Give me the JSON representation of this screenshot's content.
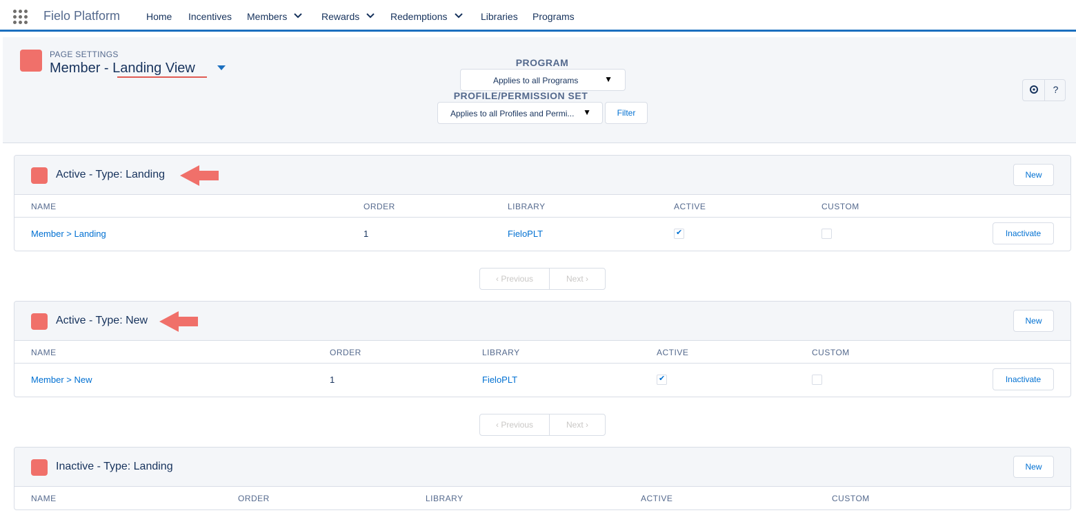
{
  "topnav": {
    "app_name": "Fielo Platform",
    "items": [
      {
        "label": "Home",
        "dropdown": false
      },
      {
        "label": "Incentives",
        "dropdown": false
      },
      {
        "label": "Members",
        "dropdown": true
      },
      {
        "label": "Rewards",
        "dropdown": true
      },
      {
        "label": "Redemptions",
        "dropdown": true
      },
      {
        "label": "Libraries",
        "dropdown": false
      },
      {
        "label": "Programs",
        "dropdown": false
      }
    ],
    "accent_color": "#1b6fbf"
  },
  "header": {
    "eyebrow": "PAGE SETTINGS",
    "title_prefix": "Member - ",
    "title_view": "Landing View",
    "program_label": "PROGRAM",
    "program_value": "Applies to all Programs",
    "profile_label": "PROFILE/PERMISSION SET",
    "profile_value": "Applies to all Profiles and Permi...",
    "filter_label": "Filter",
    "help_icons": [
      "settings-icon",
      "help-icon"
    ],
    "help_label": "?"
  },
  "sections": [
    {
      "title": "Active - Type: Landing",
      "new_label": "New",
      "columns": [
        "NAME",
        "ORDER",
        "LIBRARY",
        "ACTIVE",
        "CUSTOM"
      ],
      "rows": [
        {
          "name": "Member > Landing",
          "order": "1",
          "library": "FieloPLT",
          "active": true,
          "custom": false,
          "action": "Inactivate"
        }
      ]
    },
    {
      "title": "Active - Type: New",
      "new_label": "New",
      "columns": [
        "NAME",
        "ORDER",
        "LIBRARY",
        "ACTIVE",
        "CUSTOM"
      ],
      "rows": [
        {
          "name": "Member > New",
          "order": "1",
          "library": "FieloPLT",
          "active": true,
          "custom": false,
          "action": "Inactivate"
        }
      ]
    },
    {
      "title": "Inactive - Type: Landing",
      "new_label": "New",
      "columns": [
        "NAME",
        "ORDER",
        "LIBRARY",
        "ACTIVE",
        "CUSTOM"
      ],
      "rows": []
    }
  ],
  "pagination": {
    "previous": "Previous",
    "next": "Next"
  },
  "colors": {
    "brand_icon": "#f0706a",
    "link": "#0070d2",
    "annotation": "#e05a52"
  }
}
